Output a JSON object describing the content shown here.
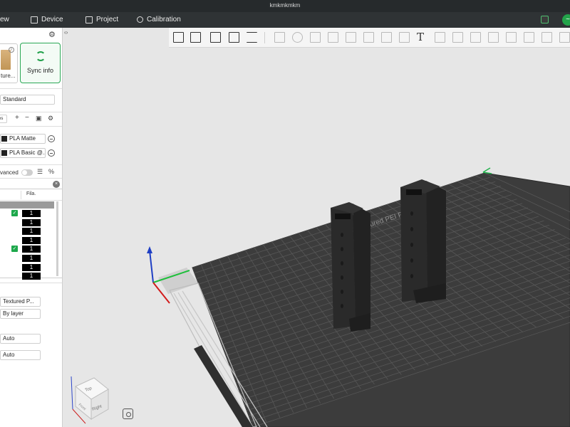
{
  "window": {
    "title": "kmkmkmkm"
  },
  "menubar": {
    "items": [
      {
        "label": "ew",
        "icon": ""
      },
      {
        "label": "Device",
        "icon": "monitor-icon"
      },
      {
        "label": "Project",
        "icon": "project-icon"
      },
      {
        "label": "Calibration",
        "icon": "calibration-icon"
      }
    ]
  },
  "left_panel": {
    "printer_label": "ture...",
    "sync_label": "Sync info",
    "process_preset": "Standard",
    "filaments": [
      {
        "name": "PLA Matte",
        "color": "#222222"
      },
      {
        "name": "PLA Basic @...",
        "color": "#222222"
      }
    ],
    "advanced_label": "vanced",
    "object_list": {
      "column_header": "Fila.",
      "rows": [
        {
          "checked": true,
          "filament": "1"
        },
        {
          "checked": false,
          "filament": "1"
        },
        {
          "checked": false,
          "filament": "1"
        },
        {
          "checked": false,
          "filament": "1"
        },
        {
          "checked": true,
          "filament": "1"
        },
        {
          "checked": false,
          "filament": "1"
        },
        {
          "checked": false,
          "filament": "1"
        },
        {
          "checked": false,
          "filament": "1"
        }
      ]
    },
    "settings": {
      "plate_type": "Textured P...",
      "sequence": "By layer",
      "option_a": "Auto",
      "option_b": "Auto"
    }
  },
  "navcube": {
    "top": "Top",
    "right": "Right",
    "front": "Front"
  },
  "plate": {
    "label": "Bambu Textured PEI Plate"
  },
  "colors": {
    "accent": "#23a34a",
    "titlebar": "#262a2c",
    "menubar": "#2f3335",
    "plate": "#3b3b3b",
    "grid": "#5a5a5a",
    "model": "#2b2b2b"
  }
}
